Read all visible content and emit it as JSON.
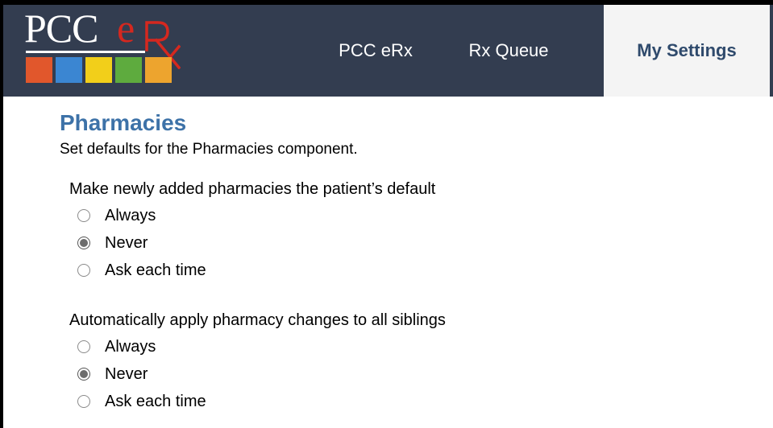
{
  "logo": {
    "text_pcc": "PCC",
    "text_e": "e",
    "squares": [
      "#e1572c",
      "#3b86d2",
      "#f2cf1a",
      "#5eab3e",
      "#eda42e"
    ],
    "accent": "#d5281f"
  },
  "nav": {
    "erx_label": "PCC eRx",
    "queue_label": "Rx Queue",
    "settings_label": "My Settings"
  },
  "page": {
    "title": "Pharmacies",
    "subtitle": "Set defaults for the Pharmacies component."
  },
  "groups": [
    {
      "label": "Make newly added pharmacies the patient’s default",
      "options": [
        {
          "label": "Always",
          "checked": false
        },
        {
          "label": "Never",
          "checked": true
        },
        {
          "label": "Ask each time",
          "checked": false
        }
      ]
    },
    {
      "label": "Automatically apply pharmacy changes to all siblings",
      "options": [
        {
          "label": "Always",
          "checked": false
        },
        {
          "label": "Never",
          "checked": true
        },
        {
          "label": "Ask each time",
          "checked": false
        }
      ]
    }
  ],
  "colors": {
    "header_bg": "#333d50",
    "title": "#3d72a8",
    "active_tab_bg": "#f4f4f4"
  }
}
